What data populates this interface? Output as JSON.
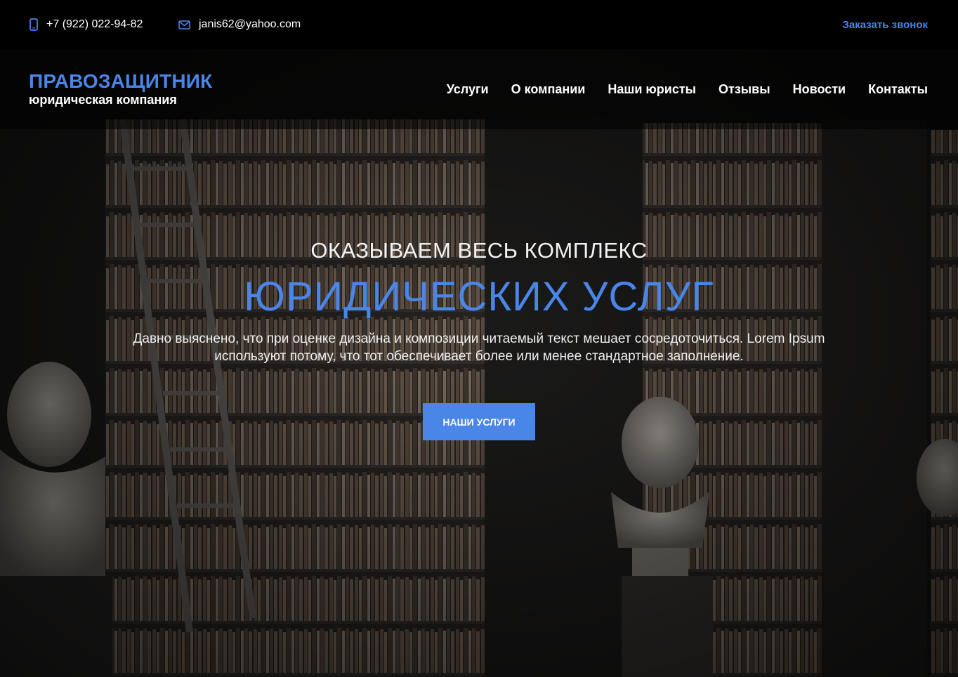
{
  "topbar": {
    "phone": "+7 (922) 022-94-82",
    "phone_icon": "phone-icon",
    "email": "janis62@yahoo.com",
    "email_icon": "mail-icon",
    "callback_label": "Заказать звонок"
  },
  "header": {
    "logo_title": "ПРАВОЗАЩИТНИК",
    "logo_subtitle": "юридическая компания",
    "nav": [
      {
        "label": "Услуги"
      },
      {
        "label": "О компании"
      },
      {
        "label": "Наши юристы"
      },
      {
        "label": "Отзывы"
      },
      {
        "label": "Новости"
      },
      {
        "label": "Контакты"
      }
    ]
  },
  "hero": {
    "kicker": "ОКАЗЫВАЕМ ВЕСЬ КОМПЛЕКС",
    "title": "ЮРИДИЧЕСКИХ УСЛУГ",
    "text": "Давно выяснено, что при оценке дизайна и композиции читаемый текст мешает сосредоточиться. Lorem Ipsum используют потому, что тот обеспечивает более или менее стандартное заполнение.",
    "button_label": "НАШИ УСЛУГИ"
  },
  "colors": {
    "accent": "#4a86e8",
    "topbar_bg": "#000000",
    "text": "#ffffff"
  }
}
